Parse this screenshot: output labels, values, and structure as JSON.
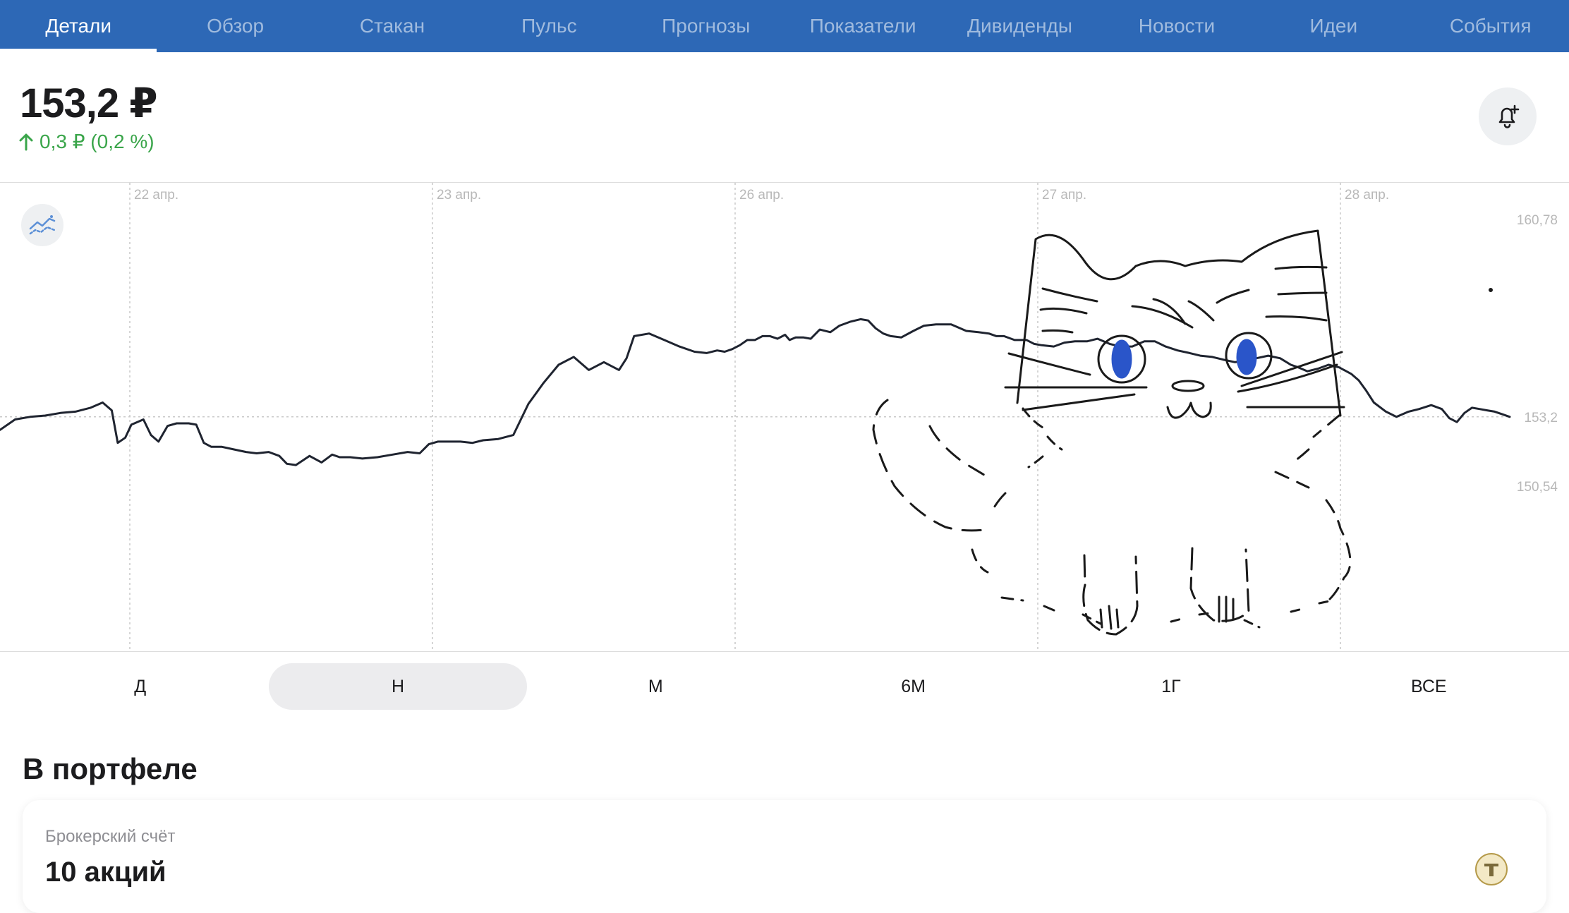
{
  "tabs": [
    {
      "label": "Детали",
      "active": true
    },
    {
      "label": "Обзор"
    },
    {
      "label": "Стакан"
    },
    {
      "label": "Пульс"
    },
    {
      "label": "Прогнозы"
    },
    {
      "label": "Показатели"
    },
    {
      "label": "Дивиденды"
    },
    {
      "label": "Новости"
    },
    {
      "label": "Идеи"
    },
    {
      "label": "События"
    }
  ],
  "quote": {
    "price": "153,2 ₽",
    "change": "0,3 ₽ (0,2 %)",
    "change_direction": "up"
  },
  "chart_data": {
    "type": "line",
    "x_tick_labels": [
      "22 апр.",
      "23 апр.",
      "26 апр.",
      "27 апр.",
      "28 апр."
    ],
    "y_tick_labels": [
      "160,78",
      "153,2",
      "150,54"
    ],
    "ylim": [
      150.54,
      160.78
    ],
    "grid": true,
    "current_value_line": 153.2,
    "series": [
      {
        "x": [
          0,
          0.01,
          0.02,
          0.03,
          0.04,
          0.05,
          0.06,
          0.068,
          0.074,
          0.078,
          0.083,
          0.087,
          0.095,
          0.1,
          0.105,
          0.111,
          0.117,
          0.125,
          0.13,
          0.135,
          0.14,
          0.147,
          0.155,
          0.163,
          0.17,
          0.178,
          0.185,
          0.19,
          0.196,
          0.205,
          0.213,
          0.22,
          0.225,
          0.232,
          0.24,
          0.25,
          0.26,
          0.27,
          0.278,
          0.284,
          0.29,
          0.3,
          0.305,
          0.313,
          0.32,
          0.33,
          0.34,
          0.35,
          0.36,
          0.37,
          0.38,
          0.39,
          0.4,
          0.41,
          0.415,
          0.42,
          0.43,
          0.44,
          0.45,
          0.46,
          0.468,
          0.475,
          0.48,
          0.485,
          0.49,
          0.495,
          0.5,
          0.505,
          0.51,
          0.515,
          0.52,
          0.523,
          0.527,
          0.532,
          0.537,
          0.543,
          0.55,
          0.556,
          0.563,
          0.57,
          0.575,
          0.58,
          0.585,
          0.59,
          0.597,
          0.605,
          0.612,
          0.62,
          0.63,
          0.64,
          0.648,
          0.655,
          0.66,
          0.665,
          0.672,
          0.68,
          0.685,
          0.69,
          0.698,
          0.705,
          0.712,
          0.72,
          0.727,
          0.735,
          0.742,
          0.75,
          0.758,
          0.765,
          0.772,
          0.78,
          0.788,
          0.795,
          0.803,
          0.81,
          0.818,
          0.825,
          0.832,
          0.84,
          0.848,
          0.855,
          0.86,
          0.866,
          0.873,
          0.88,
          0.887,
          0.895,
          0.9,
          0.905,
          0.91,
          0.918,
          0.925,
          0.933,
          0.94,
          0.948,
          0.955,
          0.96,
          0.965,
          0.97,
          0.975,
          0.98,
          0.985,
          0.99,
          0.995,
          1.0
        ],
        "y": [
          152.7,
          153.1,
          153.2,
          153.25,
          153.35,
          153.4,
          153.55,
          153.75,
          153.45,
          152.2,
          152.4,
          152.9,
          153.1,
          152.5,
          152.25,
          152.85,
          152.95,
          152.95,
          152.9,
          152.2,
          152.05,
          152.05,
          151.95,
          151.85,
          151.8,
          151.85,
          151.7,
          151.4,
          151.35,
          151.7,
          151.45,
          151.75,
          151.65,
          151.65,
          151.6,
          151.65,
          151.75,
          151.85,
          151.8,
          152.15,
          152.25,
          152.25,
          152.25,
          152.2,
          152.3,
          152.35,
          152.5,
          153.7,
          154.5,
          155.2,
          155.5,
          155.0,
          155.3,
          155.0,
          155.45,
          156.3,
          156.4,
          156.15,
          155.9,
          155.7,
          155.65,
          155.75,
          155.7,
          155.8,
          155.95,
          156.15,
          156.15,
          156.3,
          156.3,
          156.2,
          156.35,
          156.15,
          156.25,
          156.25,
          156.2,
          156.55,
          156.45,
          156.7,
          156.85,
          156.95,
          156.9,
          156.6,
          156.4,
          156.3,
          156.25,
          156.5,
          156.7,
          156.75,
          156.75,
          156.5,
          156.45,
          156.4,
          156.3,
          156.3,
          156.15,
          156.15,
          156.0,
          155.95,
          155.9,
          156.05,
          156.1,
          156.1,
          156.2,
          156.0,
          155.9,
          155.9,
          156.1,
          156.1,
          155.9,
          155.75,
          155.65,
          155.55,
          155.5,
          155.4,
          155.3,
          155.35,
          155.45,
          155.55,
          155.45,
          155.2,
          155.1,
          154.95,
          155.05,
          155.2,
          155.1,
          154.85,
          154.6,
          154.2,
          153.75,
          153.4,
          153.2,
          153.4,
          153.5,
          153.65,
          153.5,
          153.15,
          153.0,
          153.35,
          153.55,
          153.5,
          153.45,
          153.4,
          153.3,
          153.2
        ]
      }
    ]
  },
  "periods": [
    {
      "label": "Д"
    },
    {
      "label": "Н",
      "active": true
    },
    {
      "label": "М"
    },
    {
      "label": "6М"
    },
    {
      "label": "1Г"
    },
    {
      "label": "ВСЕ"
    }
  ],
  "portfolio": {
    "title": "В портфеле",
    "account_label": "Брокерский счёт",
    "holdings": "10 акций"
  },
  "colors": {
    "tabbar": "#2d68b6",
    "positive": "#3aa54a",
    "chart_line": "#1f2430",
    "drawing_eyes": "#2a55c9"
  },
  "icons": {
    "alert": "bell-plus-icon",
    "indicators": "indicators-icon",
    "change_arrow": "arrow-up-icon",
    "broker_logo": "bank-logo-icon"
  }
}
